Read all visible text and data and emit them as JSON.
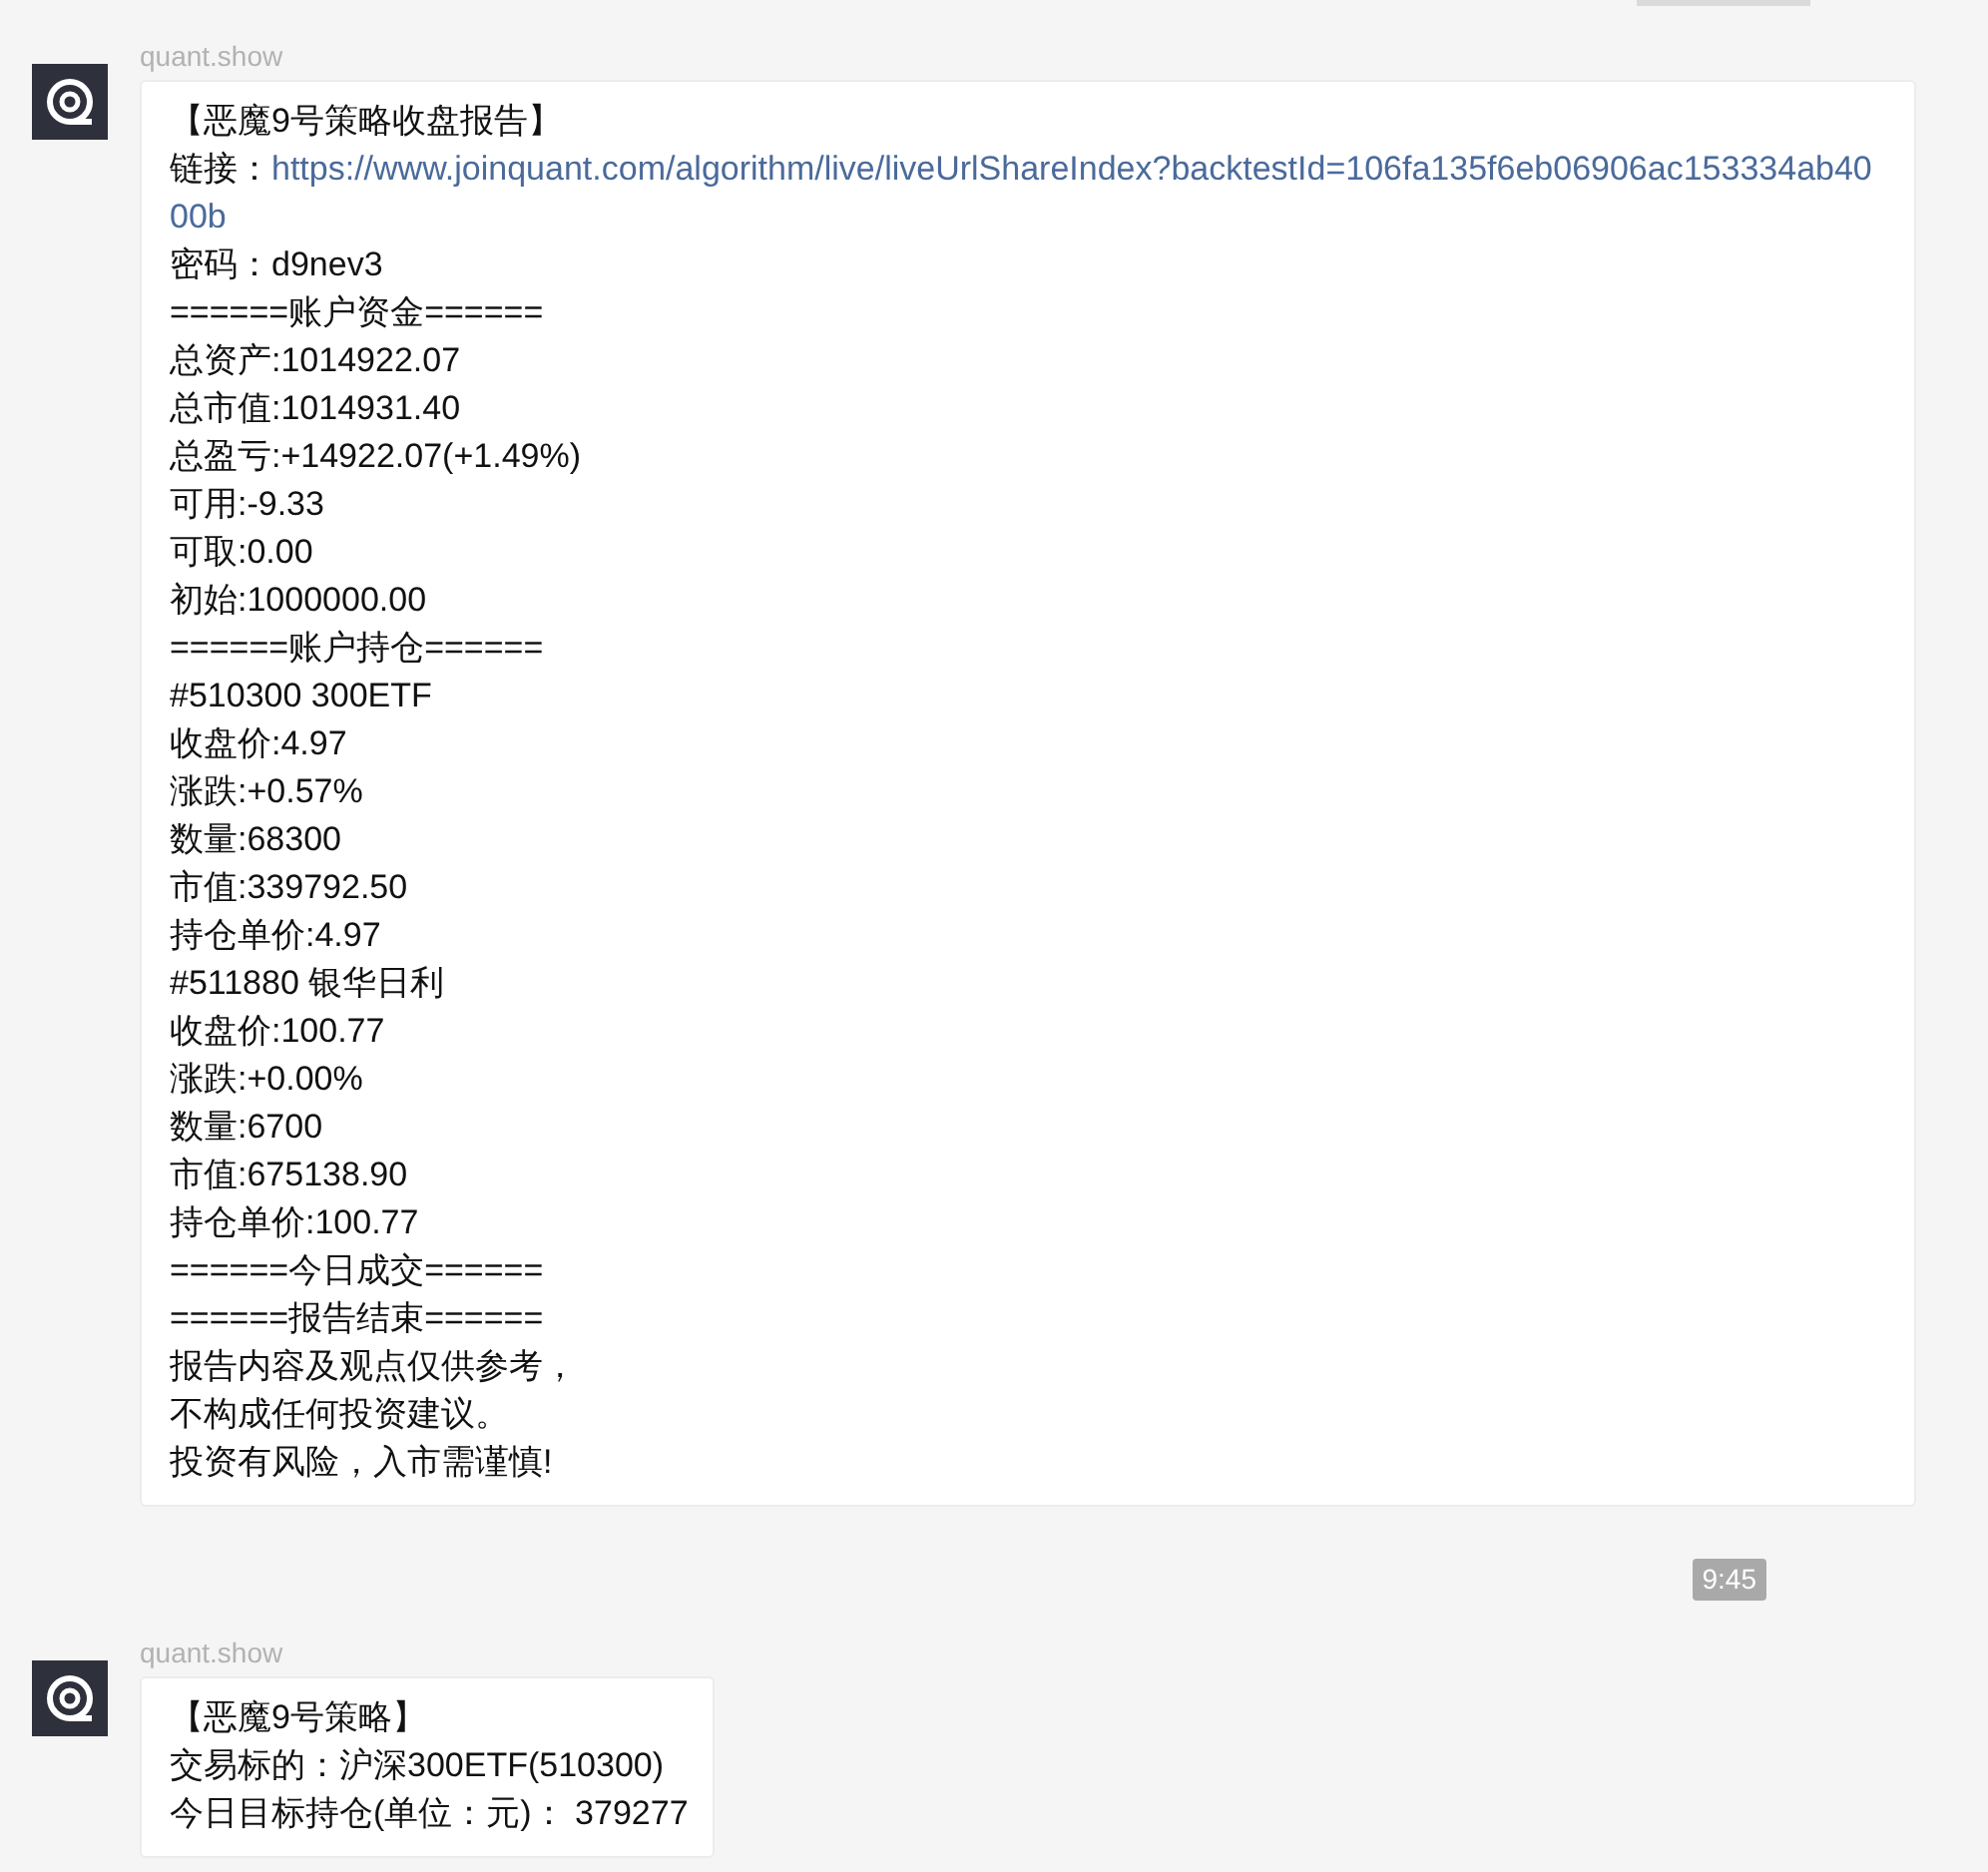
{
  "top_badge": {
    "kind": "cut"
  },
  "messages": [
    {
      "kind": "message",
      "sender": "quant.show",
      "lines": [
        {
          "kind": "text",
          "text": "【恶魔9号策略收盘报告】"
        },
        {
          "kind": "link",
          "label": "链接：",
          "url": "https://www.joinquant.com/algorithm/live/liveUrlShareIndex?backtestId=106fa135f6eb06906ac153334ab4000b"
        },
        {
          "kind": "text",
          "text": "密码：d9nev3"
        },
        {
          "kind": "text",
          "text": "======账户资金======"
        },
        {
          "kind": "text",
          "text": "总资产:1014922.07"
        },
        {
          "kind": "text",
          "text": "总市值:1014931.40"
        },
        {
          "kind": "text",
          "text": "总盈亏:+14922.07(+1.49%)"
        },
        {
          "kind": "text",
          "text": "可用:-9.33"
        },
        {
          "kind": "text",
          "text": "可取:0.00"
        },
        {
          "kind": "text",
          "text": "初始:1000000.00"
        },
        {
          "kind": "text",
          "text": "======账户持仓======"
        },
        {
          "kind": "text",
          "text": "#510300 300ETF"
        },
        {
          "kind": "text",
          "text": "收盘价:4.97"
        },
        {
          "kind": "text",
          "text": "涨跌:+0.57%"
        },
        {
          "kind": "text",
          "text": "数量:68300"
        },
        {
          "kind": "text",
          "text": "市值:339792.50"
        },
        {
          "kind": "text",
          "text": "持仓单价:4.97"
        },
        {
          "kind": "text",
          "text": "#511880 银华日利"
        },
        {
          "kind": "text",
          "text": "收盘价:100.77"
        },
        {
          "kind": "text",
          "text": "涨跌:+0.00%"
        },
        {
          "kind": "text",
          "text": "数量:6700"
        },
        {
          "kind": "text",
          "text": "市值:675138.90"
        },
        {
          "kind": "text",
          "text": "持仓单价:100.77"
        },
        {
          "kind": "text",
          "text": "======今日成交======"
        },
        {
          "kind": "text",
          "text": "======报告结束======"
        },
        {
          "kind": "text",
          "text": "报告内容及观点仅供参考，"
        },
        {
          "kind": "text",
          "text": "不构成任何投资建议。"
        },
        {
          "kind": "text",
          "text": "投资有风险，入市需谨慎!"
        }
      ]
    },
    {
      "kind": "time",
      "text": "9:45"
    },
    {
      "kind": "message",
      "sender": "quant.show",
      "lines": [
        {
          "kind": "text",
          "text": "【恶魔9号策略】"
        },
        {
          "kind": "text",
          "text": "交易标的：沪深300ETF(510300)"
        },
        {
          "kind": "text",
          "text": "今日目标持仓(单位：元)： 379277"
        }
      ]
    }
  ]
}
